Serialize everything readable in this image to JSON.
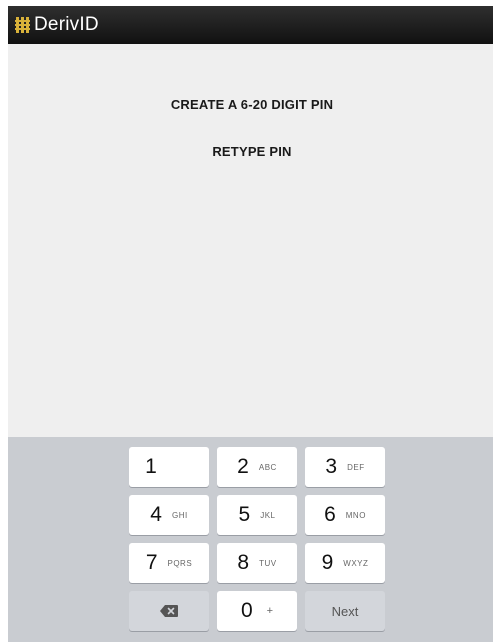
{
  "window": {
    "title": "DerivID",
    "logo_icon": "derivid-chip-logo"
  },
  "main": {
    "create_prompt": "CREATE A 6-20 DIGIT PIN",
    "retype_prompt": "RETYPE PIN"
  },
  "keypad": {
    "keys": [
      {
        "digit": "1",
        "letters": ""
      },
      {
        "digit": "2",
        "letters": "ABC"
      },
      {
        "digit": "3",
        "letters": "DEF"
      },
      {
        "digit": "4",
        "letters": "GHI"
      },
      {
        "digit": "5",
        "letters": "JKL"
      },
      {
        "digit": "6",
        "letters": "MNO"
      },
      {
        "digit": "7",
        "letters": "PQRS"
      },
      {
        "digit": "8",
        "letters": "TUV"
      },
      {
        "digit": "9",
        "letters": "WXYZ"
      },
      {
        "digit": "0",
        "letters": "+"
      }
    ],
    "backspace_icon": "backspace-icon",
    "next_label": "Next"
  },
  "colors": {
    "titlebar": "#1b1b1b",
    "background": "#efefef",
    "keyboard": "#c9ccd1",
    "key": "#ffffff",
    "function_key": "#d3d6db"
  }
}
